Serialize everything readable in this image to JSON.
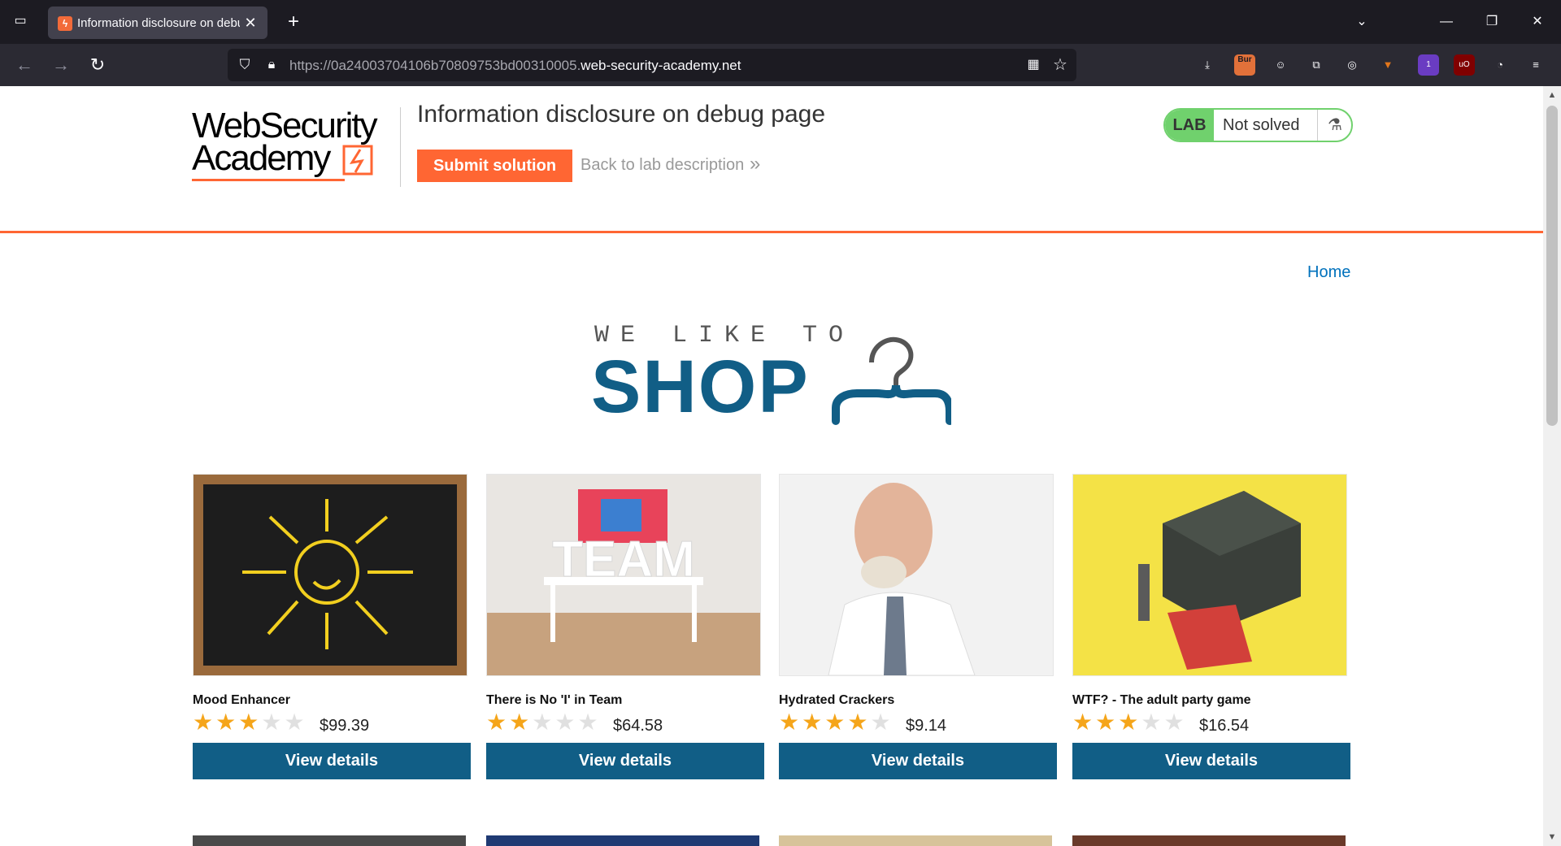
{
  "browser": {
    "tab_title": "Information disclosure on debu",
    "url_prefix": "https://0a24003704106b70809753bd00310005.",
    "url_domain": "web-security-academy.net",
    "ext_badges": {
      "burp": "Bur",
      "notify": "1",
      "ublock": "uO"
    }
  },
  "header": {
    "logo_line1": "WebSecurity",
    "logo_line2": "Academy",
    "lab_title": "Information disclosure on debug page",
    "submit_label": "Submit solution",
    "back_label": "Back to lab description",
    "status_tag": "LAB",
    "status_text": "Not solved"
  },
  "nav": {
    "home": "Home"
  },
  "hero": {
    "top": "WE LIKE TO",
    "main": "SHOP"
  },
  "products": [
    {
      "name": "Mood Enhancer",
      "rating": 3,
      "price": "$99.39",
      "button": "View details"
    },
    {
      "name": "There is No 'I' in Team",
      "rating": 2,
      "price": "$64.58",
      "button": "View details"
    },
    {
      "name": "Hydrated Crackers",
      "rating": 4,
      "price": "$9.14",
      "button": "View details"
    },
    {
      "name": "WTF? - The adult party game",
      "rating": 3,
      "price": "$16.54",
      "button": "View details"
    }
  ],
  "colors": {
    "accent": "#ff6633",
    "primary": "#115e86",
    "solved_green": "#70d16d",
    "star": "#f5a51a"
  }
}
